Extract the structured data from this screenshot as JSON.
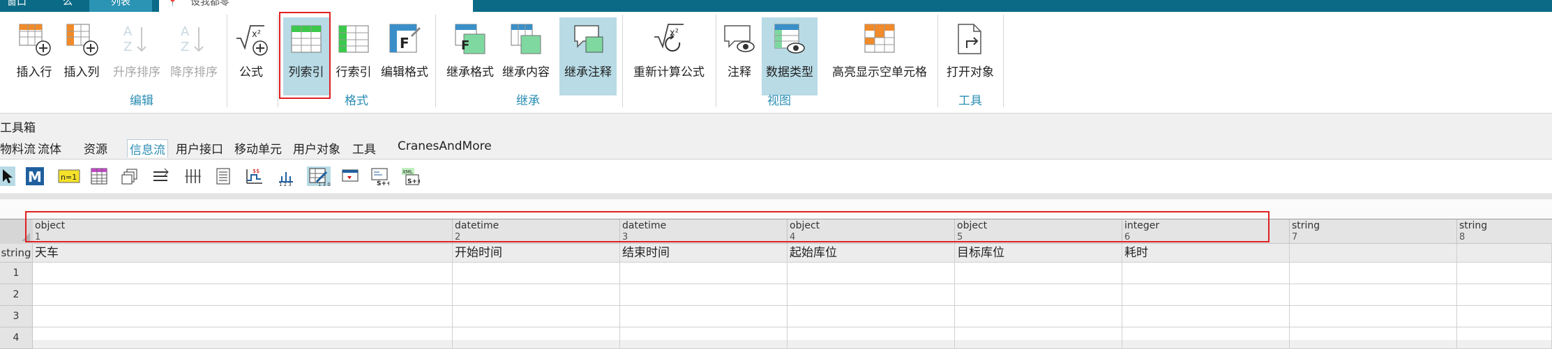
{
  "topbar": {
    "tabs": [
      "窗口",
      "么",
      "列表"
    ],
    "doc_tab": "设我都零"
  },
  "ribbon": {
    "groups": {
      "edit": "编辑",
      "format": "格式",
      "inherit": "继承",
      "view": "视图",
      "tools": "工具"
    },
    "buttons": {
      "insert_row": "插入行",
      "insert_col": "插入列",
      "sort_asc": "升序排序",
      "sort_desc": "降序排序",
      "formula": "公式",
      "col_index": "列索引",
      "row_index": "行索引",
      "edit_format": "编辑格式",
      "inherit_format": "继承格式",
      "inherit_content": "继承内容",
      "inherit_comment": "继承注释",
      "recalc_formula": "重新计算公式",
      "comment": "注释",
      "data_type": "数据类型",
      "highlight_empty": "高亮显示空单元格",
      "open_object": "打开对象"
    }
  },
  "toolbox": {
    "title": "工具箱",
    "tabs": [
      "物料流",
      "流体",
      "资源",
      "信息流",
      "用户接口",
      "移动单元",
      "用户对象",
      "工具",
      "CranesAndMore"
    ],
    "active_tab": "信息流"
  },
  "grid": {
    "row_header_type": "string",
    "columns": [
      {
        "type": "object",
        "index": "1",
        "name": "天车"
      },
      {
        "type": "datetime",
        "index": "2",
        "name": "开始时间"
      },
      {
        "type": "datetime",
        "index": "3",
        "name": "结束时间"
      },
      {
        "type": "object",
        "index": "4",
        "name": "起始库位"
      },
      {
        "type": "object",
        "index": "5",
        "name": "目标库位"
      },
      {
        "type": "integer",
        "index": "6",
        "name": "耗时"
      },
      {
        "type": "string",
        "index": "7",
        "name": ""
      },
      {
        "type": "string",
        "index": "8",
        "name": ""
      }
    ],
    "rows": [
      "1",
      "2",
      "3",
      "4"
    ]
  }
}
